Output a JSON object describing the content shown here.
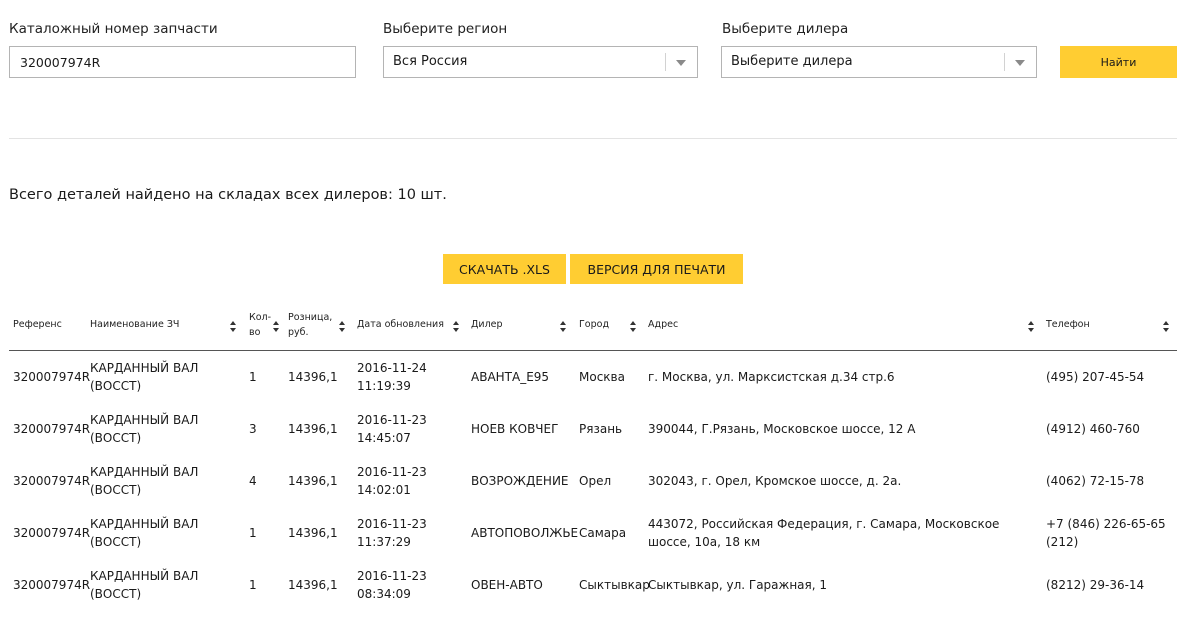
{
  "form": {
    "part_label": "Каталожный номер запчасти",
    "part_value": "320007974R",
    "region_label": "Выберите регион",
    "region_value": "Вся Россия",
    "dealer_label": "Выберите дилера",
    "dealer_value": "Выберите дилера",
    "search_label": "Найти"
  },
  "summary": "Всего деталей найдено на складах всех дилеров: 10 шт.",
  "actions": {
    "xls_label": "СКАЧАТЬ .XLS",
    "print_label": "ВЕРСИЯ ДЛЯ ПЕЧАТИ"
  },
  "table": {
    "headers": [
      "Референс",
      "Наименование ЗЧ",
      "Кол-\nво",
      "Розница,\nруб.",
      "Дата обновления",
      "Дилер",
      "Город",
      "Адрес",
      "Телефон"
    ],
    "rows": [
      [
        "320007974R",
        "КАРДАННЫЙ ВАЛ (ВОССТ)",
        "1",
        "14396,1",
        "2016-11-24 11:19:39",
        "АВАНТА_Е95",
        "Москва",
        "г. Москва, ул. Марксистская д.34 стр.6",
        "(495) 207-45-54"
      ],
      [
        "320007974R",
        "КАРДАННЫЙ ВАЛ (ВОССТ)",
        "3",
        "14396,1",
        "2016-11-23 14:45:07",
        "НОЕВ КОВЧЕГ",
        "Рязань",
        "390044, Г.Рязань, Московское шоссе, 12 А",
        "(4912) 460-760"
      ],
      [
        "320007974R",
        "КАРДАННЫЙ ВАЛ (ВОССТ)",
        "4",
        "14396,1",
        "2016-11-23 14:02:01",
        "ВОЗРОЖДЕНИЕ",
        "Орел",
        "302043, г. Орел, Кромское шоссе, д. 2а.",
        "(4062) 72-15-78"
      ],
      [
        "320007974R",
        "КАРДАННЫЙ ВАЛ (ВОССТ)",
        "1",
        "14396,1",
        "2016-11-23 11:37:29",
        "АВТОПОВОЛЖЬЕ",
        "Самара",
        "443072, Российская Федерация, г. Самара, Московское шоссе, 10а, 18 км",
        "+7 (846) 226-65-65 (212)"
      ],
      [
        "320007974R",
        "КАРДАННЫЙ ВАЛ (ВОССТ)",
        "1",
        "14396,1",
        "2016-11-23 08:34:09",
        "ОВЕН-АВТО",
        "Сыктывкар",
        "Сыктывкар, ул. Гаражная, 1",
        "(8212) 29-36-14"
      ]
    ]
  },
  "colors": {
    "accent": "#ffcd32",
    "border": "#b4b4b4",
    "divider": "#e3e3e3"
  }
}
